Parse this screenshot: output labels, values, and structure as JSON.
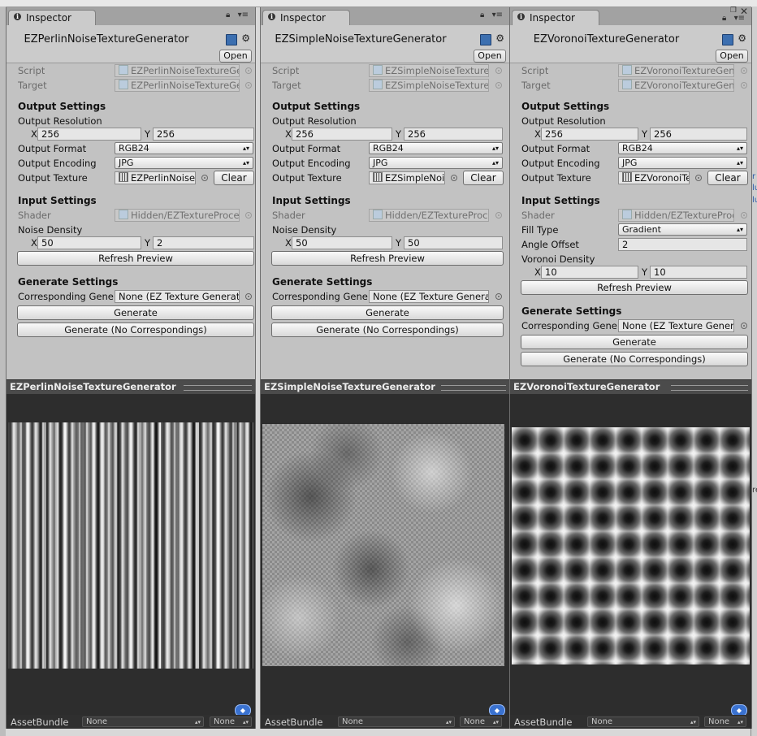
{
  "common": {
    "tab_label": "Inspector",
    "open_label": "Open",
    "script_label": "Script",
    "target_label": "Target",
    "output_settings": "Output Settings",
    "output_resolution": "Output Resolution",
    "x_axis": "X",
    "y_axis": "Y",
    "output_format_label": "Output Format",
    "output_encoding_label": "Output Encoding",
    "output_texture_label": "Output Texture",
    "clear_label": "Clear",
    "input_settings": "Input Settings",
    "shader_label": "Shader",
    "shader_value": "Hidden/EZTextureProce",
    "refresh_label": "Refresh Preview",
    "generate_settings": "Generate Settings",
    "corresponding_label": "Corresponding Gene",
    "generate_label": "Generate",
    "generate_nocorr_label": "Generate (No Correspondings)",
    "assetbundle_label": "AssetBundle",
    "none_label": "None",
    "res_x": "256",
    "res_y": "256",
    "format_value": "RGB24",
    "encoding_value": "JPG"
  },
  "panels": [
    {
      "title": "EZPerlinNoiseTextureGenerator",
      "script_value": "EZPerlinNoiseTextureGe",
      "target_value": "EZPerlinNoiseTextureGe",
      "output_texture_value": "EZPerlinNoiseT",
      "noise_density_label": "Noise Density",
      "noise_x": "50",
      "noise_y": "2",
      "corresponding_value": "None (EZ Texture Generat",
      "preview_title": "EZPerlinNoiseTextureGenerator"
    },
    {
      "title": "EZSimpleNoiseTextureGenerator",
      "script_value": "EZSimpleNoiseTexture",
      "target_value": "EZSimpleNoiseTexture",
      "output_texture_value": "EZSimpleNois",
      "noise_density_label": "Noise Density",
      "noise_x": "50",
      "noise_y": "50",
      "corresponding_value": "None (EZ Texture Genera",
      "preview_title": "EZSimpleNoiseTextureGenerator"
    },
    {
      "title": "EZVoronoiTextureGenerator",
      "script_value": "EZVoronoiTextureGen",
      "target_value": "EZVoronoiTextureGen",
      "output_texture_value": "EZVoronoiTe",
      "fill_type_label": "Fill Type",
      "fill_type_value": "Gradient",
      "angle_offset_label": "Angle Offset",
      "angle_offset_value": "2",
      "voronoi_density_label": "Voronoi Density",
      "voronoi_x": "10",
      "voronoi_y": "10",
      "corresponding_value": "None (EZ Texture Gener",
      "preview_title": "EZVoronoiTextureGenerator"
    }
  ],
  "right_edge_text": [
    "r",
    "lu",
    "lu",
    "re"
  ]
}
